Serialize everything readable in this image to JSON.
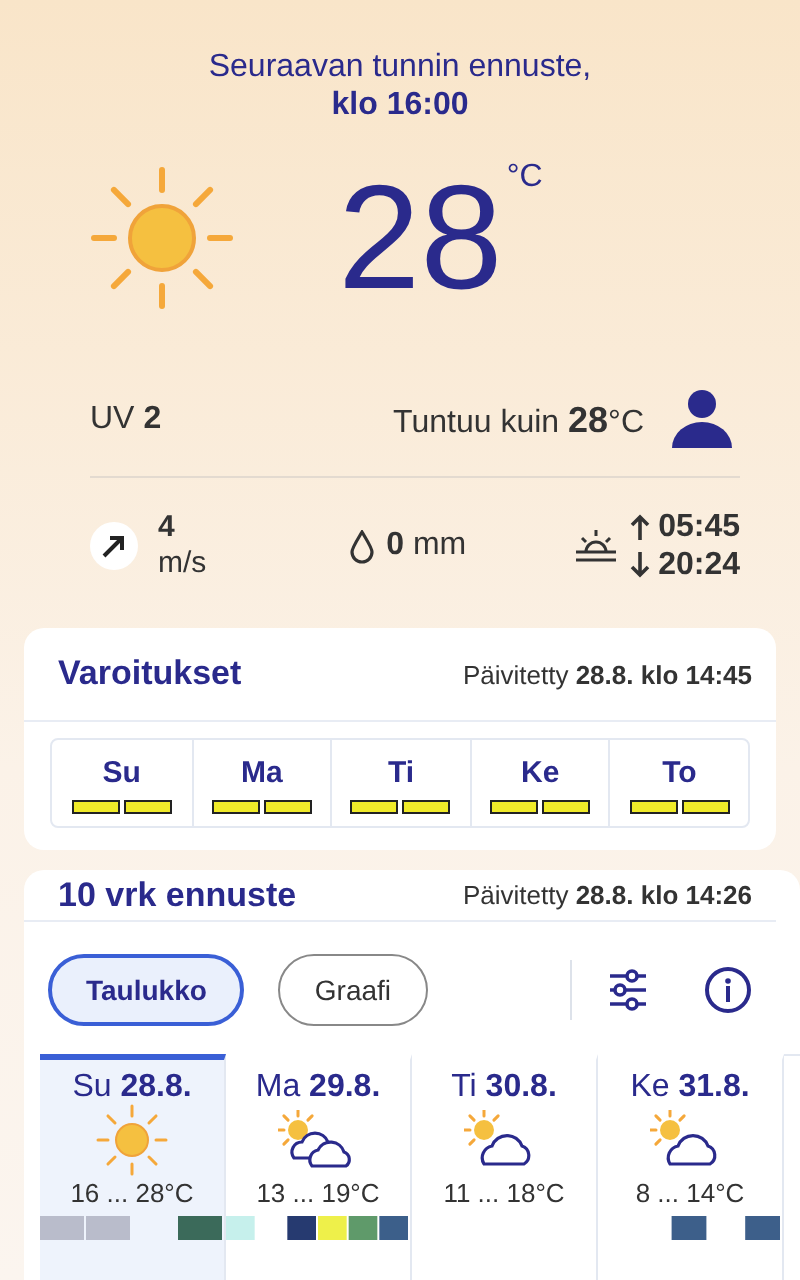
{
  "current": {
    "heading": "Seuraavan tunnin ennuste,",
    "time": "klo 16:00",
    "kind": "sunny",
    "temperature": "28",
    "unit": "°C",
    "uv_label": "UV",
    "uv_value": "2",
    "feels_label": "Tuntuu kuin",
    "feels_value": "28",
    "feels_unit": "°C",
    "wind_speed": "4",
    "wind_unit": "m/s",
    "rain_value": "0",
    "rain_unit": "mm",
    "sunrise": "05:45",
    "sunset": "20:24"
  },
  "warnings": {
    "title": "Varoitukset",
    "updated_label": "Päivitetty",
    "updated_value": "28.8. klo 14:45",
    "days": [
      {
        "label": "Su",
        "bars": [
          {
            "color": "#f0ea2a"
          },
          {
            "color": "#f0ea2a"
          }
        ]
      },
      {
        "label": "Ma",
        "bars": [
          {
            "color": "#f0ea2a"
          },
          {
            "color": "#f0ea2a"
          }
        ]
      },
      {
        "label": "Ti",
        "bars": [
          {
            "color": "#f0ea2a"
          },
          {
            "color": "#f0ea2a"
          }
        ]
      },
      {
        "label": "Ke",
        "bars": [
          {
            "color": "#f0ea2a"
          },
          {
            "color": "#f0ea2a"
          }
        ]
      },
      {
        "label": "To",
        "bars": [
          {
            "color": "#f0ea2a"
          },
          {
            "color": "#f0ea2a"
          }
        ]
      }
    ]
  },
  "forecast": {
    "title": "10 vrk ennuste",
    "updated_label": "Päivitetty",
    "updated_value": "28.8. klo 14:26",
    "views": [
      {
        "label": "Taulukko",
        "selected": true
      },
      {
        "label": "Graafi",
        "selected": false
      }
    ],
    "days": [
      {
        "weekday": "Su",
        "date": "28.8.",
        "kind": "sunny",
        "range": "16 ... 28°C",
        "selected": true
      },
      {
        "weekday": "Ma",
        "date": "29.8.",
        "kind": "partly-cloudy",
        "range": "13 ... 19°C",
        "selected": false
      },
      {
        "weekday": "Ti",
        "date": "30.8.",
        "kind": "sun-cloud",
        "range": "11 ... 18°C",
        "selected": false
      },
      {
        "weekday": "Ke",
        "date": "31.8.",
        "kind": "sun-cloud",
        "range": "8 ... 14°C",
        "selected": false
      }
    ]
  }
}
